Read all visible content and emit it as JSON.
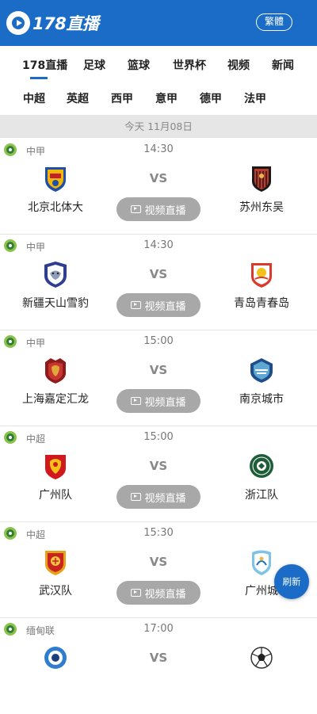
{
  "header": {
    "logo_text": "178直播",
    "lang_button": "繁體"
  },
  "nav_primary": [
    "178直播",
    "足球",
    "篮球",
    "世界杯",
    "视频",
    "新闻"
  ],
  "nav_secondary": [
    "中超",
    "英超",
    "西甲",
    "意甲",
    "德甲",
    "法甲"
  ],
  "date_label": "今天 11月08日",
  "vs_label": "VS",
  "live_label": "视频直播",
  "refresh_label": "刷新",
  "matches": [
    {
      "league": "中甲",
      "time": "14:30",
      "home": "北京北体大",
      "away": "苏州东吴"
    },
    {
      "league": "中甲",
      "time": "14:30",
      "home": "新疆天山雪豹",
      "away": "青岛青春岛"
    },
    {
      "league": "中甲",
      "time": "15:00",
      "home": "上海嘉定汇龙",
      "away": "南京城市"
    },
    {
      "league": "中超",
      "time": "15:00",
      "home": "广州队",
      "away": "浙江队"
    },
    {
      "league": "中超",
      "time": "15:30",
      "home": "武汉队",
      "away": "广州城"
    },
    {
      "league": "缅甸联",
      "time": "17:00",
      "home": "",
      "away": ""
    }
  ],
  "colors": {
    "brand": "#1a6cc6",
    "live_button": "#a8a8a8",
    "date_bar": "#e6e6e6"
  }
}
